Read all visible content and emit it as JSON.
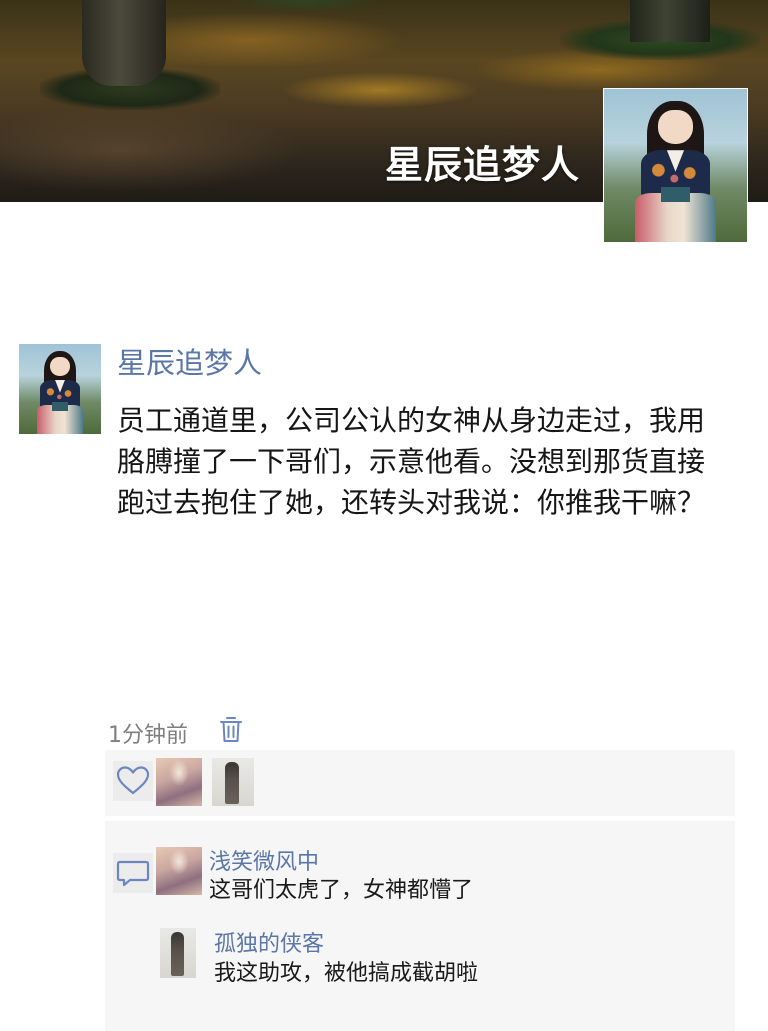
{
  "cover": {
    "title": "星辰追梦人"
  },
  "post": {
    "author": "星辰追梦人",
    "text": "员工通道里，公司公认的女神从身边走过，我用胳膊撞了一下哥们，示意他看。没想到那货直接跑过去抱住了她，还转头对我说：你推我干嘛？",
    "timestamp": "1分钟前"
  },
  "likes": {
    "icon": "heart-icon",
    "avatars": [
      "like-avatar-1",
      "like-avatar-2"
    ]
  },
  "comments": [
    {
      "author": "浅笑微风中",
      "text": "这哥们太虎了，女神都懵了"
    },
    {
      "author": "孤独的侠客",
      "text": "我这助攻，被他搞成截胡啦"
    }
  ],
  "colors": {
    "link": "#5b77a8",
    "text": "#161616",
    "muted": "#7f7f7f",
    "panel": "#f6f6f6"
  }
}
